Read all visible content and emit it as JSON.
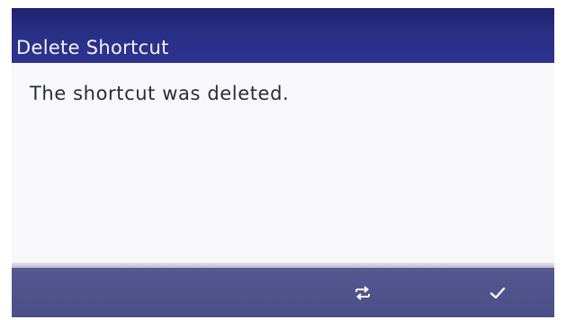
{
  "dialog": {
    "title": "Delete Shortcut",
    "message": "The shortcut was deleted."
  },
  "softkeys": [
    {
      "icon": "swap-arrows-icon"
    },
    {
      "icon": "checkmark-icon"
    }
  ],
  "colors": {
    "titlebar": "#2a2f86",
    "content_background": "#f8f8fa",
    "bottombar": "#50538c",
    "text_light": "#f2f2f8",
    "text_dark": "#2a2b3d"
  }
}
